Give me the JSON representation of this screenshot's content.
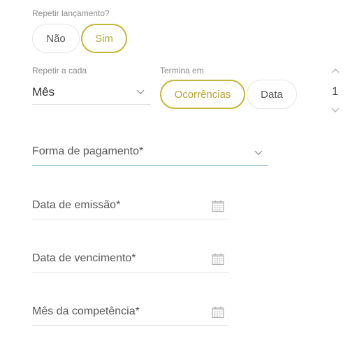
{
  "repeat": {
    "label": "Repetir lançamento?",
    "options": [
      "Não",
      "Sim"
    ],
    "selected": "Sim"
  },
  "frequency": {
    "label": "Repetir a cada",
    "value": "Mês"
  },
  "ends": {
    "label": "Termina em",
    "options": [
      "Ocorrências",
      "Data"
    ],
    "selected": "Ocorrências"
  },
  "occurrences": {
    "value": "1"
  },
  "payment": {
    "placeholder": "Forma de pagamento*"
  },
  "issue_date": {
    "placeholder": "Data de emissão*"
  },
  "due_date": {
    "placeholder": "Data de vencimento*"
  },
  "competence_month": {
    "placeholder": "Mês da competência*"
  },
  "colors": {
    "accent": "#c6b63a",
    "payment_underline": "#7fb7c4"
  }
}
